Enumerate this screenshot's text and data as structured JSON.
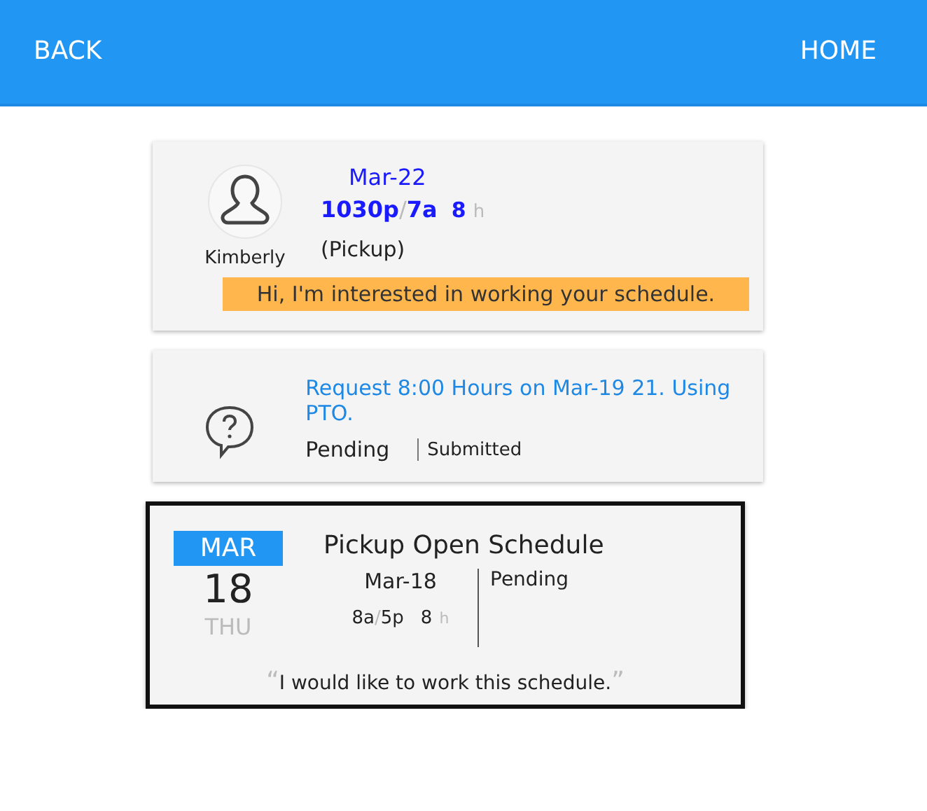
{
  "header": {
    "back": "BACK",
    "home": "HOME"
  },
  "cards": [
    {
      "kind": "trade",
      "selected": false,
      "person": "Kimberly",
      "date": "Mar-22",
      "start": "1030p",
      "separator": "/",
      "end": "7a",
      "hours": "8",
      "hours_unit": "h",
      "type": "(Pickup)",
      "message": "Hi, I'm interested in working your schedule."
    },
    {
      "kind": "request",
      "selected": false,
      "text": "Request 8:00 Hours on Mar-19 21. Using PTO.",
      "status": "Pending",
      "substatus": "Submitted"
    },
    {
      "kind": "open",
      "selected": true,
      "month": "MAR",
      "day": "18",
      "weekday": "THU",
      "title": "Pickup Open Schedule",
      "date": "Mar-18",
      "start": "8a",
      "separator": "/",
      "end": "5p",
      "hours": "8",
      "hours_unit": "h",
      "status": "Pending",
      "open_quote": "“",
      "comment": "I would like to work this schedule.",
      "close_quote": "”"
    }
  ]
}
